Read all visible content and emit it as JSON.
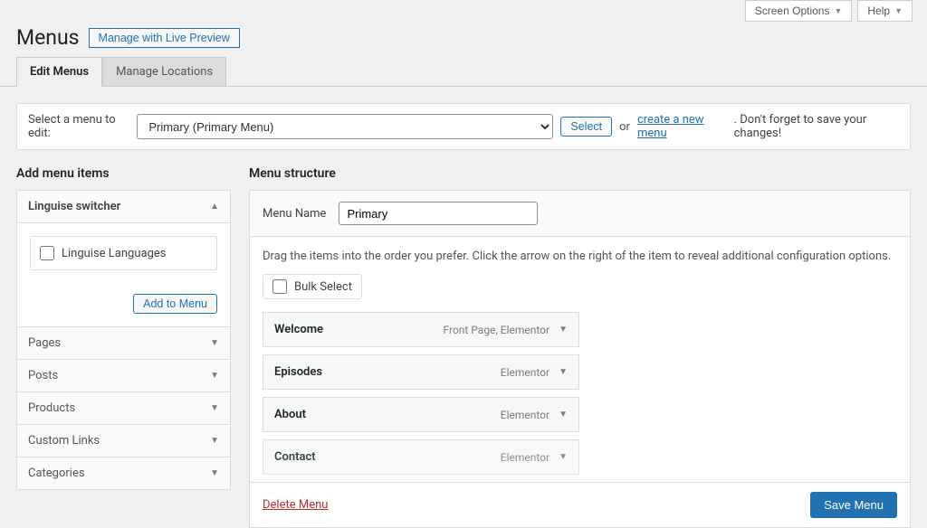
{
  "topbar": {
    "screen_options": "Screen Options",
    "help": "Help"
  },
  "header": {
    "title": "Menus",
    "live_preview_btn": "Manage with Live Preview"
  },
  "tabs": {
    "edit": "Edit Menus",
    "manage": "Manage Locations"
  },
  "select_row": {
    "label": "Select a menu to edit:",
    "current": "Primary (Primary Menu)",
    "select_btn": "Select",
    "or": "or",
    "create_link": "create a new menu",
    "tail": ". Don't forget to save your changes!"
  },
  "left": {
    "title": "Add menu items",
    "box1_title": "Linguise switcher",
    "box1_check_label": "Linguise Languages",
    "add_btn": "Add to Menu",
    "boxes": [
      "Pages",
      "Posts",
      "Products",
      "Custom Links",
      "Categories"
    ]
  },
  "right": {
    "title": "Menu structure",
    "name_label": "Menu Name",
    "name_value": "Primary",
    "drag_hint": "Drag the items into the order you prefer. Click the arrow on the right of the item to reveal additional configuration options.",
    "bulk_label": "Bulk Select",
    "items": [
      {
        "title": "Welcome",
        "type": "Front Page, Elementor"
      },
      {
        "title": "Episodes",
        "type": "Elementor"
      },
      {
        "title": "About",
        "type": "Elementor"
      },
      {
        "title": "Contact",
        "type": "Elementor"
      }
    ],
    "delete": "Delete Menu",
    "save": "Save Menu"
  }
}
